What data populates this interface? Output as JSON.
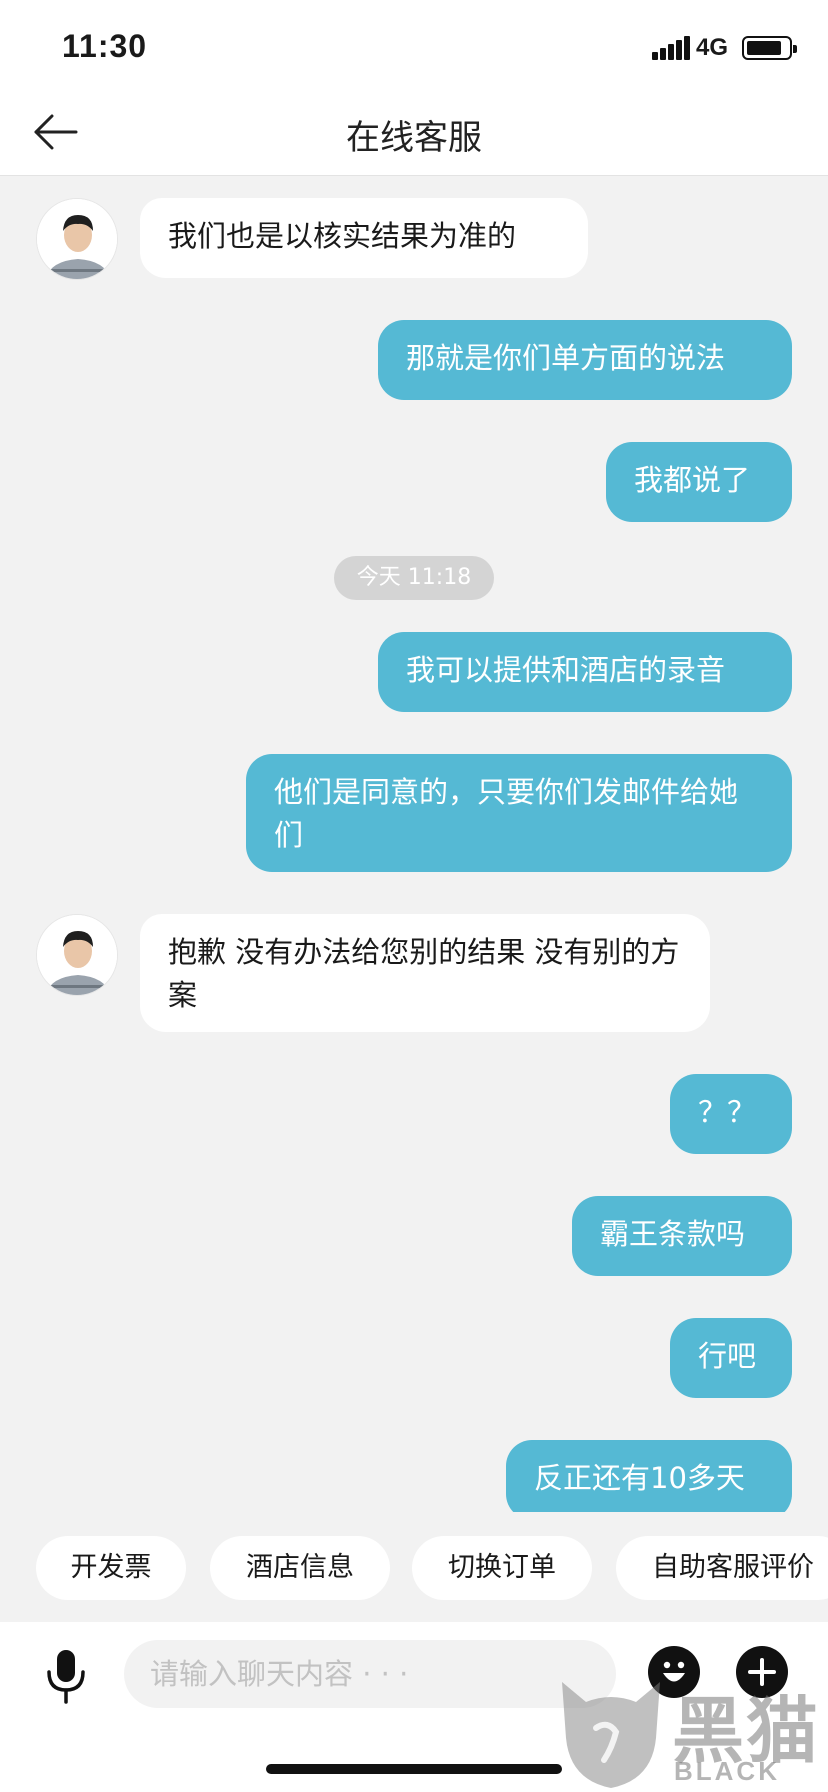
{
  "status_bar": {
    "time": "11:30",
    "network": "4G"
  },
  "nav": {
    "title": "在线客服"
  },
  "messages": [
    {
      "side": "in",
      "text": "我们也是以核实结果为准的"
    },
    {
      "side": "out",
      "text": "那就是你们单方面的说法"
    },
    {
      "side": "out",
      "text": "我都说了"
    },
    {
      "side": "out",
      "text": "我可以提供和酒店的录音"
    },
    {
      "side": "out",
      "text": "他们是同意的，只要你们发邮件给她们"
    },
    {
      "side": "in",
      "text": "抱歉  没有办法给您别的结果 没有别的方案"
    },
    {
      "side": "out",
      "text": "？？"
    },
    {
      "side": "out",
      "text": "霸王条款吗"
    },
    {
      "side": "out",
      "text": "行吧"
    },
    {
      "side": "out",
      "text": "反正还有10多天"
    }
  ],
  "timestamp": "今天 11:18",
  "quick_replies": [
    "开发票",
    "酒店信息",
    "切换订单",
    "自助客服评价"
  ],
  "input": {
    "placeholder": "请输入聊天内容 · · ·"
  },
  "icons": {
    "back": "arrow-left-icon",
    "mic": "microphone-icon",
    "emoji": "emoji-icon",
    "add": "plus-icon"
  },
  "watermark": {
    "cn": "黑猫",
    "en": "BLACK CAT"
  },
  "colors": {
    "outgoing_bubble": "#55b9d4",
    "incoming_bubble": "#ffffff",
    "background": "#f2f2f2"
  }
}
